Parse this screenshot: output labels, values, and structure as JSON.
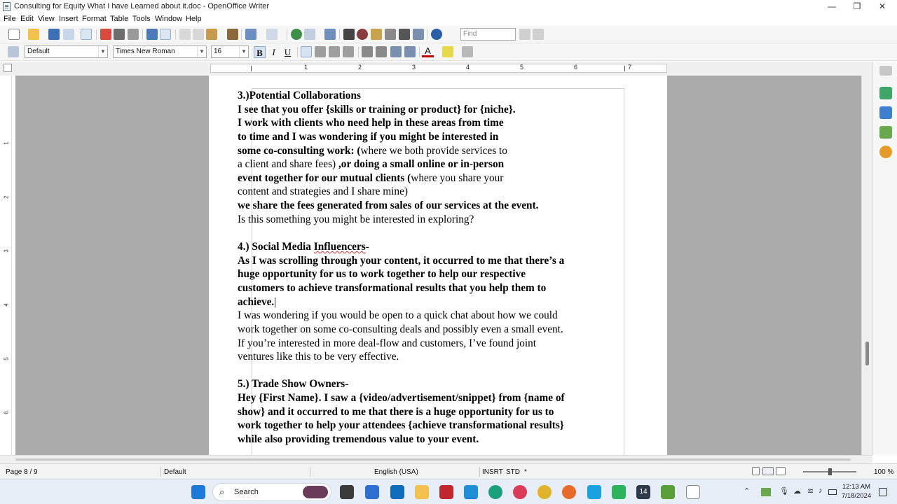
{
  "window": {
    "title": "Consulting for Equity What I have Learned about it.doc - OpenOffice Writer",
    "minimize": "—",
    "maximize": "❐",
    "close": "✕"
  },
  "menu": [
    "File",
    "Edit",
    "View",
    "Insert",
    "Format",
    "Table",
    "Tools",
    "Window",
    "Help"
  ],
  "toolbar": {
    "find_placeholder": "Find"
  },
  "format_toolbar": {
    "style": "Default",
    "font": "Times New Roman",
    "size": "16",
    "bold": "B",
    "italic": "I",
    "underline": "U",
    "font_color_label": "A"
  },
  "ruler": {
    "numbers": [
      "1",
      "2",
      "3",
      "4",
      "5",
      "6",
      "7"
    ],
    "vertical_numbers": [
      "1",
      "2",
      "3",
      "4",
      "5",
      "6"
    ]
  },
  "document": {
    "lines": [
      {
        "segments": [
          {
            "t": "3.)Potential Collaborations",
            "b": true
          }
        ]
      },
      {
        "segments": [
          {
            "t": "I see that you offer {skills or training or product} for {niche}.",
            "b": true
          }
        ]
      },
      {
        "segments": [
          {
            "t": "I work with clients who need help in these areas from time",
            "b": true
          }
        ]
      },
      {
        "segments": [
          {
            "t": "to time and I was wondering if you might be interested in",
            "b": true
          }
        ]
      },
      {
        "segments": [
          {
            "t": "some co-consulting work: (",
            "b": true
          },
          {
            "t": "where we both provide services to",
            "b": false
          }
        ]
      },
      {
        "segments": [
          {
            "t": "a client and share fees) ",
            "b": false
          },
          {
            "t": ",or doing a small online or in-person",
            "b": true
          }
        ]
      },
      {
        "segments": [
          {
            "t": "event together for our mutual clients (",
            "b": true
          },
          {
            "t": "where you share your",
            "b": false
          }
        ]
      },
      {
        "segments": [
          {
            "t": "content and strategies and I share mine)",
            "b": false
          }
        ]
      },
      {
        "segments": [
          {
            "t": "we share the fees generated from sales of our services at the event.",
            "b": true
          }
        ]
      },
      {
        "segments": [
          {
            "t": "Is this something you might be interested in exploring?",
            "b": false
          }
        ]
      },
      {
        "segments": [
          {
            "t": "",
            "b": false
          }
        ]
      },
      {
        "segments": [
          {
            "t": "4.) Social Media ",
            "b": true
          },
          {
            "t": "Influencers",
            "b": true,
            "w": true
          },
          {
            "t": "-",
            "b": false
          }
        ]
      },
      {
        "segments": [
          {
            "t": "As I was scrolling through your content, it occurred to me that there’s a",
            "b": true
          }
        ]
      },
      {
        "segments": [
          {
            "t": "huge opportunity for us to work together to help our respective",
            "b": true
          }
        ]
      },
      {
        "segments": [
          {
            "t": "customers to achieve transformational results that you help them to",
            "b": true
          }
        ]
      },
      {
        "segments": [
          {
            "t": "achieve.",
            "b": true
          },
          {
            "t": "|",
            "b": false
          }
        ]
      },
      {
        "segments": [
          {
            "t": "I was wondering if you would be open to a quick chat about how we could",
            "b": false
          }
        ]
      },
      {
        "segments": [
          {
            "t": "work together on some co-consulting deals and possibly even a small event.",
            "b": false
          }
        ]
      },
      {
        "segments": [
          {
            "t": "If you’re interested in more deal-flow and customers, I’ve found joint",
            "b": false
          }
        ]
      },
      {
        "segments": [
          {
            "t": "ventures like this to be very effective.",
            "b": false
          }
        ]
      },
      {
        "segments": [
          {
            "t": "",
            "b": false
          }
        ]
      },
      {
        "segments": [
          {
            "t": "5.) Trade Show Owners",
            "b": true
          },
          {
            "t": "-",
            "b": false
          }
        ]
      },
      {
        "segments": [
          {
            "t": "Hey {First Name}. I saw a {video/advertisement/snippet} from {name of",
            "b": true
          }
        ]
      },
      {
        "segments": [
          {
            "t": "show} and it occurred to me that there is a huge opportunity for us to",
            "b": true
          }
        ]
      },
      {
        "segments": [
          {
            "t": "work together to help your attendees {achieve transformational results}",
            "b": true
          }
        ]
      },
      {
        "segments": [
          {
            "t": "while also providing tremendous value to your event.",
            "b": true
          }
        ]
      }
    ]
  },
  "status": {
    "page": "Page 8 / 9",
    "style": "Default",
    "language": "English (USA)",
    "insert_mode": "INSRT",
    "selection_mode": "STD",
    "modified": "*",
    "zoom": "100 %"
  },
  "taskbar": {
    "search": "Search",
    "time": "12:13 AM",
    "date": "7/18/2024",
    "calendar_day": "14"
  },
  "colors": {
    "accent": "#2a6ebb",
    "workspace": "#ababab",
    "taskbar": "#e8eef7"
  }
}
